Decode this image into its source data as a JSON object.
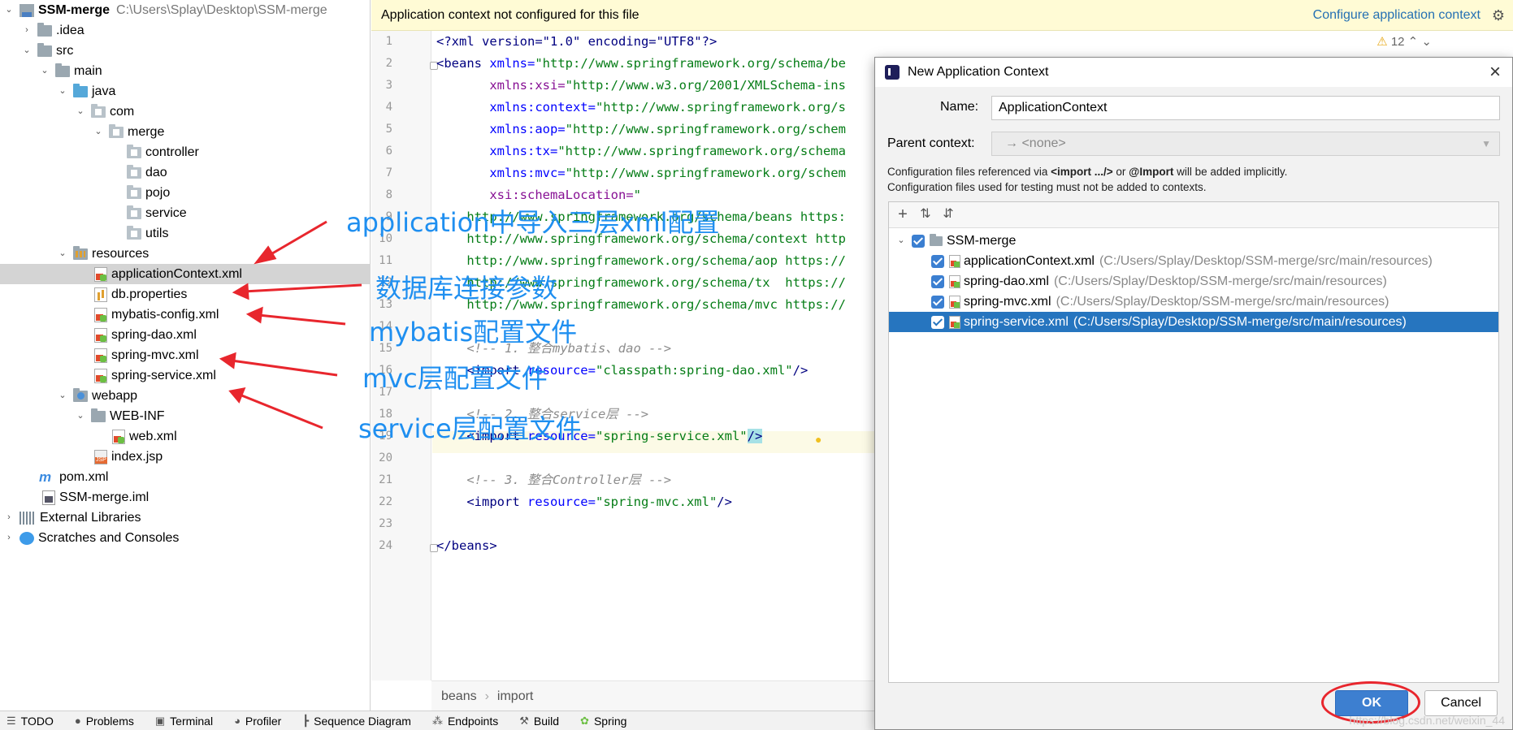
{
  "tree": {
    "items": [
      {
        "label": "SSM-merge",
        "path": "C:\\Users\\Splay\\Desktop\\SSM-merge",
        "bold": true
      },
      {
        "label": ".idea"
      },
      {
        "label": "src"
      },
      {
        "label": "main"
      },
      {
        "label": "java"
      },
      {
        "label": "com"
      },
      {
        "label": "merge"
      },
      {
        "label": "controller"
      },
      {
        "label": "dao"
      },
      {
        "label": "pojo"
      },
      {
        "label": "service"
      },
      {
        "label": "utils"
      },
      {
        "label": "resources"
      },
      {
        "label": "applicationContext.xml"
      },
      {
        "label": "db.properties"
      },
      {
        "label": "mybatis-config.xml"
      },
      {
        "label": "spring-dao.xml"
      },
      {
        "label": "spring-mvc.xml"
      },
      {
        "label": "spring-service.xml"
      },
      {
        "label": "webapp"
      },
      {
        "label": "WEB-INF"
      },
      {
        "label": "web.xml"
      },
      {
        "label": "index.jsp"
      },
      {
        "label": "pom.xml"
      },
      {
        "label": "SSM-merge.iml"
      },
      {
        "label": "External Libraries"
      },
      {
        "label": "Scratches and Consoles"
      }
    ]
  },
  "editor": {
    "banner": "Application context not configured for this file",
    "configure_link": "Configure application context",
    "warning_count": "12",
    "line_numbers": [
      "1",
      "2",
      "3",
      "4",
      "5",
      "6",
      "7",
      "8",
      "9",
      "10",
      "11",
      "12",
      "13",
      "14",
      "15",
      "16",
      "17",
      "18",
      "19",
      "20",
      "21",
      "22",
      "23",
      "24"
    ],
    "lines": {
      "l1": "<?xml version=\"1.0\" encoding=\"UTF8\"?>",
      "l2a": "<beans ",
      "l2b": "xmlns=",
      "l2c": "\"http://www.springframework.org/schema/be",
      "l3a": "       xmlns:xsi=",
      "l3b": "\"http://www.w3.org/2001/XMLSchema-ins",
      "l4a": "       xmlns:context=",
      "l4b": "\"http://www.springframework.org/s",
      "l5a": "       xmlns:aop=",
      "l5b": "\"http://www.springframework.org/schem",
      "l6a": "       xmlns:tx=",
      "l6b": "\"http://www.springframework.org/schema",
      "l7a": "       xmlns:mvc=",
      "l7b": "\"http://www.springframework.org/schem",
      "l8a": "       xsi:schemaLocation=",
      "l8b": "\"",
      "l9": "    http://www.springframework.org/schema/beans https:",
      "l10": "    http://www.springframework.org/schema/context http",
      "l11": "    http://www.springframework.org/schema/aop https://",
      "l12": "    http://www.springframework.org/schema/tx  https://",
      "l13": "    http://www.springframework.org/schema/mvc https://",
      "l15": "    <!-- 1. 整合mybatis、dao -->",
      "l16a": "    <import ",
      "l16b": "resource=",
      "l16c": "\"classpath:spring-dao.xml\"",
      "l16d": "/>",
      "l18": "    <!-- 2. 整合service层 -->",
      "l19a": "    <import ",
      "l19b": "resource=",
      "l19c": "\"spring-service.xml\"",
      "l19d": "/>",
      "l21": "    <!-- 3. 整合Controller层 -->",
      "l22a": "    <import ",
      "l22b": "resource=",
      "l22c": "\"spring-mvc.xml\"",
      "l22d": "/>",
      "l24": "</beans>"
    },
    "breadcrumb": [
      "beans",
      "import"
    ]
  },
  "annotations": [
    "application中导入三层xml配置",
    "数据库连接参数",
    "mybatis配置文件",
    "mvc层配置文件",
    "service层配置文件"
  ],
  "dialog": {
    "title": "New Application Context",
    "name_label": "Name:",
    "name_value": "ApplicationContext",
    "parent_label": "Parent context:",
    "parent_value": "<none>",
    "info1_a": "Configuration files referenced via ",
    "info1_b": "<import .../>",
    "info1_c": " or ",
    "info1_d": "@Import",
    "info1_e": " will be added implicitly.",
    "info2": "Configuration files used for testing must not be added to contexts.",
    "root": "SSM-merge",
    "files": [
      {
        "name": "applicationContext.xml",
        "path": "(C:/Users/Splay/Desktop/SSM-merge/src/main/resources)"
      },
      {
        "name": "spring-dao.xml",
        "path": "(C:/Users/Splay/Desktop/SSM-merge/src/main/resources)"
      },
      {
        "name": "spring-mvc.xml",
        "path": "(C:/Users/Splay/Desktop/SSM-merge/src/main/resources)"
      },
      {
        "name": "spring-service.xml",
        "path": "(C:/Users/Splay/Desktop/SSM-merge/src/main/resources)"
      }
    ],
    "ok": "OK",
    "cancel": "Cancel"
  },
  "statusbar": {
    "items": [
      "TODO",
      "Problems",
      "Terminal",
      "Profiler",
      "Sequence Diagram",
      "Endpoints",
      "Build",
      "Spring"
    ]
  },
  "watermark": "https://blog.csdn.net/weixin_44"
}
